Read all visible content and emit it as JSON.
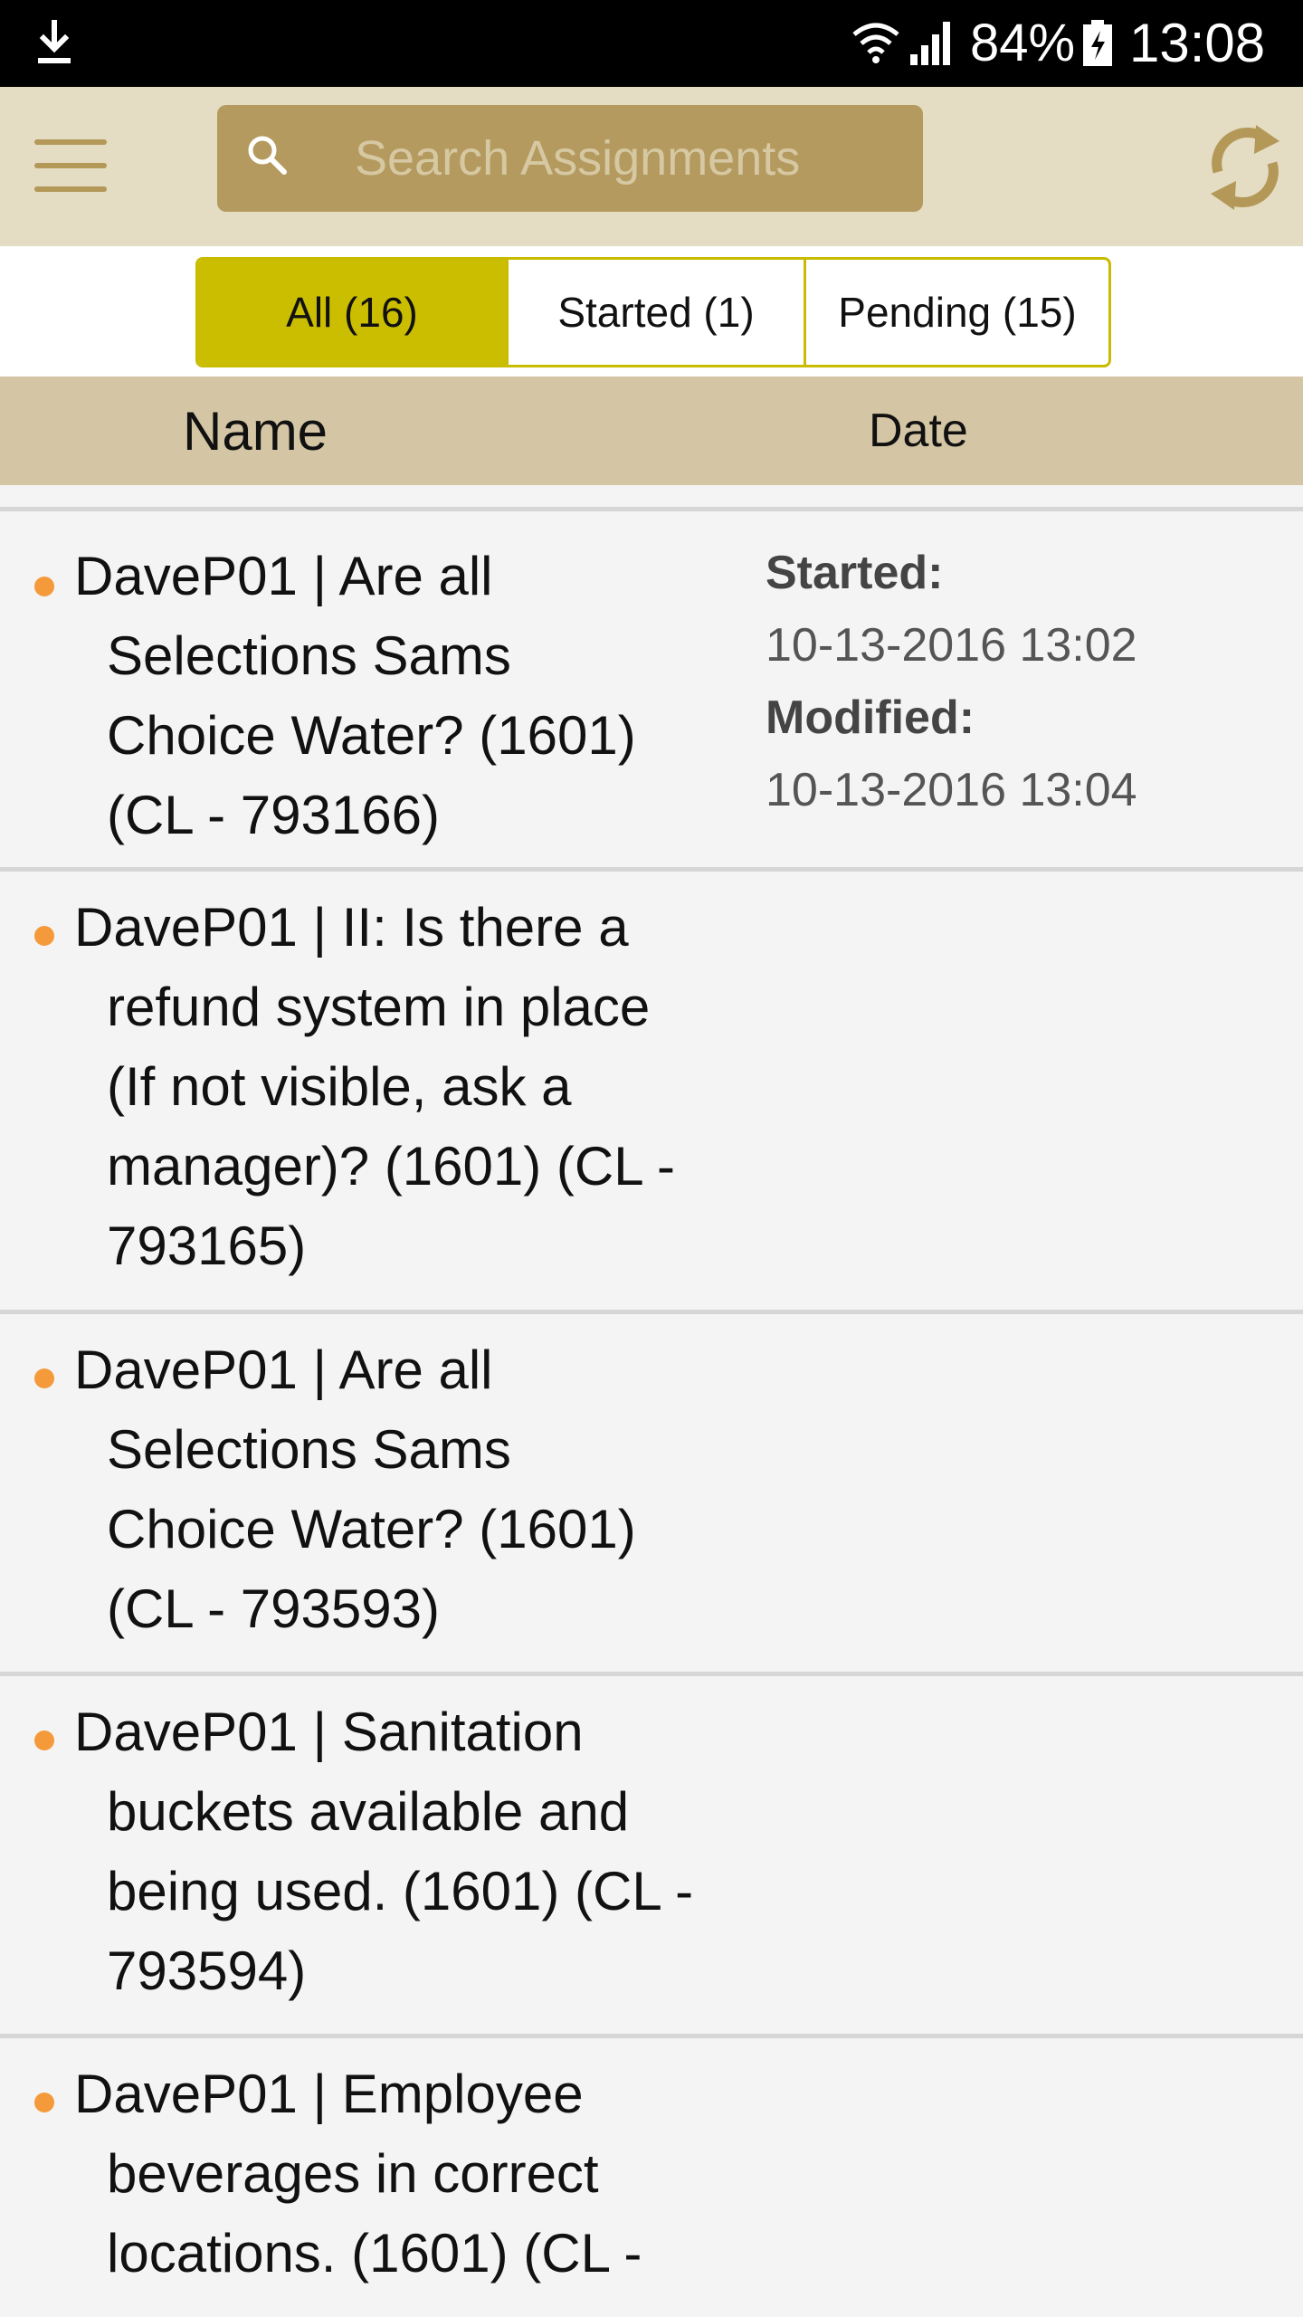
{
  "status_bar": {
    "battery_percent": "84%",
    "time": "13:08",
    "icons": [
      "download-icon",
      "wifi-icon",
      "signal-icon",
      "battery-charging-icon"
    ]
  },
  "header": {
    "search_placeholder": "Search Assignments",
    "icons": [
      "menu-icon",
      "search-icon",
      "sync-icon"
    ]
  },
  "tabs": [
    {
      "label": "All (16)",
      "selected": true
    },
    {
      "label": "Started (1)",
      "selected": false
    },
    {
      "label": "Pending (15)",
      "selected": false
    }
  ],
  "columns": {
    "name": "Name",
    "date": "Date"
  },
  "assignments": [
    {
      "lines": [
        "DaveP01 | Are all",
        "Selections Sams",
        "Choice Water? (1601)",
        "(CL - 793166)"
      ],
      "started_label": "Started:",
      "started": "10-13-2016 13:02",
      "modified_label": "Modified:",
      "modified": "10-13-2016 13:04"
    },
    {
      "lines": [
        "DaveP01 | II: Is there a",
        "refund system in place",
        "(If not visible, ask a",
        "manager)? (1601) (CL -",
        "793165)"
      ]
    },
    {
      "lines": [
        "DaveP01 | Are all",
        "Selections Sams",
        "Choice Water? (1601)",
        "(CL - 793593)"
      ]
    },
    {
      "lines": [
        "DaveP01 | Sanitation",
        "buckets available and",
        "being used. (1601) (CL -",
        "793594)"
      ]
    },
    {
      "lines": [
        "DaveP01 | Employee",
        "beverages in correct",
        "locations. (1601) (CL -"
      ]
    }
  ],
  "colors": {
    "header_bg": "#e4dcc3",
    "search_bg": "#b49a5e",
    "accent_gold": "#b39858",
    "tab_selected": "#cbbd00",
    "column_header_bg": "#d4c6a4",
    "bullet": "#f59a3a"
  }
}
